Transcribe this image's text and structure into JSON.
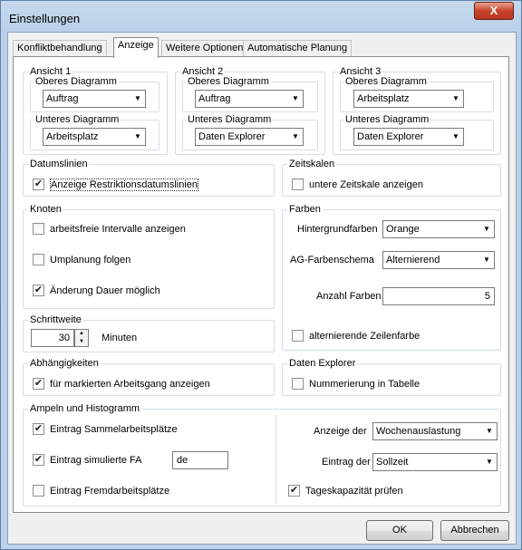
{
  "window": {
    "title": "Einstellungen",
    "close_label": "X"
  },
  "tabs": [
    {
      "label": "Konfliktbehandlung"
    },
    {
      "label": "Anzeige"
    },
    {
      "label": "Weitere Optionen"
    },
    {
      "label": "Automatische Planung"
    }
  ],
  "ansicht": [
    {
      "title": "Ansicht 1",
      "oberes_label": "Oberes Diagramm",
      "oberes_value": "Auftrag",
      "unteres_label": "Unteres Diagramm",
      "unteres_value": "Arbeitsplatz"
    },
    {
      "title": "Ansicht 2",
      "oberes_label": "Oberes Diagramm",
      "oberes_value": "Auftrag",
      "unteres_label": "Unteres Diagramm",
      "unteres_value": "Daten Explorer"
    },
    {
      "title": "Ansicht 3",
      "oberes_label": "Oberes Diagramm",
      "oberes_value": "Arbeitsplatz",
      "unteres_label": "Unteres Diagramm",
      "unteres_value": "Daten Explorer"
    }
  ],
  "datumslinien": {
    "title": "Datumslinien",
    "checkbox_label": "Anzeige Restriktionsdatumslinien",
    "checked": true
  },
  "zeitskalen": {
    "title": "Zeitskalen",
    "checkbox_label": "untere Zeitskale anzeigen",
    "checked": false
  },
  "knoten": {
    "title": "Knoten",
    "items": [
      {
        "label": "arbeitsfreie Intervalle anzeigen",
        "checked": false
      },
      {
        "label": "Umplanung folgen",
        "checked": false
      },
      {
        "label": "Änderung Dauer möglich",
        "checked": true
      }
    ]
  },
  "farben": {
    "title": "Farben",
    "hintergrund_label": "Hintergrundfarben",
    "hintergrund_value": "Orange",
    "ag_label": "AG-Farbenschema",
    "ag_value": "Alternierend",
    "anzahl_label": "Anzahl Farben",
    "anzahl_value": "5",
    "zeilenfarbe_label": "alternierende Zeilenfarbe",
    "zeilenfarbe_checked": false
  },
  "schrittweite": {
    "title": "Schrittweite",
    "value": "30",
    "unit": "Minuten"
  },
  "abhaengigkeiten": {
    "title": "Abhängigkeiten",
    "checkbox_label": "für markierten Arbeitsgang anzeigen",
    "checked": true
  },
  "daten_explorer": {
    "title": "Daten Explorer",
    "checkbox_label": "Nummerierung in Tabelle",
    "checked": false
  },
  "ampeln": {
    "title": "Ampeln und Histogramm",
    "sammel_label": "Eintrag Sammelarbeitsplätze",
    "sammel_checked": true,
    "simuliert_label": "Eintrag simulierte FA",
    "simuliert_checked": true,
    "simuliert_value": "de",
    "fremd_label": "Eintrag Fremdarbeitsplätze",
    "fremd_checked": false,
    "anzeige_label": "Anzeige der",
    "anzeige_value": "Wochenauslastung",
    "eintrag_label": "Eintrag der",
    "eintrag_value": "Sollzeit",
    "tageskap_label": "Tageskapazität prüfen",
    "tageskap_checked": true
  },
  "footer": {
    "ok_label": "OK",
    "cancel_label": "Abbrechen"
  }
}
